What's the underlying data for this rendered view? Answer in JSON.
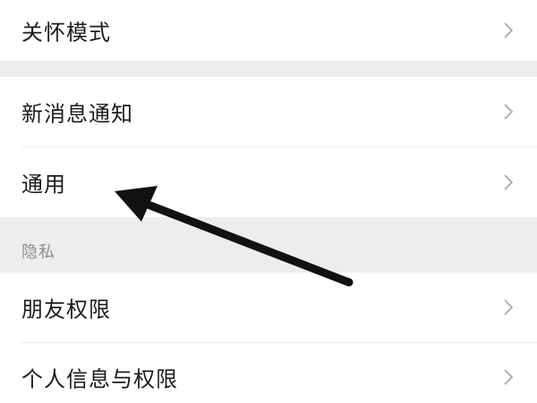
{
  "settings": {
    "items": [
      {
        "label": "关怀模式"
      },
      {
        "label": "新消息通知"
      },
      {
        "label": "通用"
      },
      {
        "label": "朋友权限"
      },
      {
        "label": "个人信息与权限"
      }
    ],
    "sections": {
      "privacy_header": "隐私"
    }
  },
  "colors": {
    "background": "#ffffff",
    "group_gap": "#ededed",
    "text": "#1b1b1b",
    "section_text": "#8f8f8f",
    "chevron": "#b2b2b2",
    "annotation_arrow": "#111111"
  },
  "icons": {
    "chevron": "chevron-right-icon",
    "annotation": "pointer-arrow-icon"
  }
}
